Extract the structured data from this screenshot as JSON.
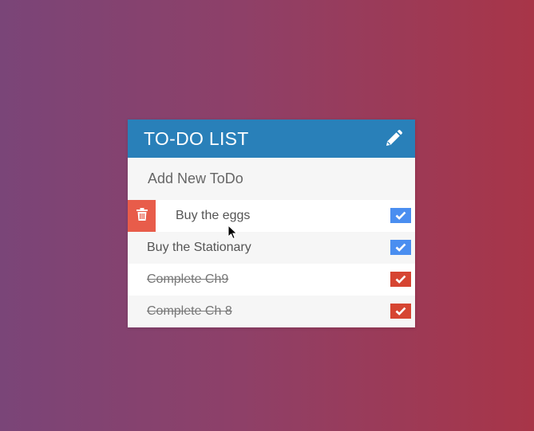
{
  "header": {
    "title": "TO-DO LIST",
    "edit_icon": "pencil-icon"
  },
  "add_todo": {
    "placeholder": "Add New ToDo",
    "value": ""
  },
  "todos": [
    {
      "label": "Buy the eggs",
      "completed": false,
      "delete_revealed": true
    },
    {
      "label": "Buy the Stationary",
      "completed": false
    },
    {
      "label": "Complete Ch9",
      "completed": true
    },
    {
      "label": "Complete Ch 8",
      "completed": true
    }
  ],
  "colors": {
    "header_bg": "#2980b9",
    "delete_bg": "#e85c4a",
    "check_active": "#4a8ef0",
    "check_done": "#d64532"
  }
}
